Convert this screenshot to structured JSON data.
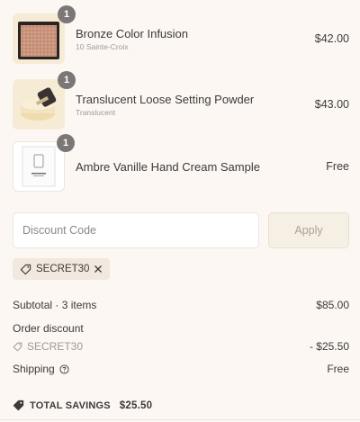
{
  "line_items": [
    {
      "name": "Bronze Color Infusion",
      "variant": "10 Sainte-Croix",
      "price": "$42.00",
      "quantity": "1",
      "image": "bronzer-compact"
    },
    {
      "name": "Translucent Loose Setting Powder",
      "variant": "Translucent",
      "price": "$43.00",
      "quantity": "1",
      "image": "loose-powder-jar"
    },
    {
      "name": "Ambre Vanille Hand Cream Sample",
      "variant": "",
      "price": "Free",
      "quantity": "1",
      "image": "sample-card"
    }
  ],
  "discount": {
    "placeholder": "Discount Code",
    "value": "",
    "apply_label": "Apply",
    "applied_code": "SECRET30"
  },
  "summary": {
    "subtotal_label": "Subtotal · 3 items",
    "subtotal_value": "$85.00",
    "order_discount_label": "Order discount",
    "discount_code": "SECRET30",
    "discount_value": "- $25.50",
    "shipping_label": "Shipping",
    "shipping_value": "Free"
  },
  "savings": {
    "label": "TOTAL SAVINGS",
    "value": "$25.50"
  },
  "colors": {
    "background": "#fcf7f3",
    "badge": "#7b7776",
    "chip": "#f1e9de",
    "apply_button": "#f6efe4"
  },
  "icons": [
    "tag-icon",
    "close-icon",
    "help-circle-icon"
  ]
}
